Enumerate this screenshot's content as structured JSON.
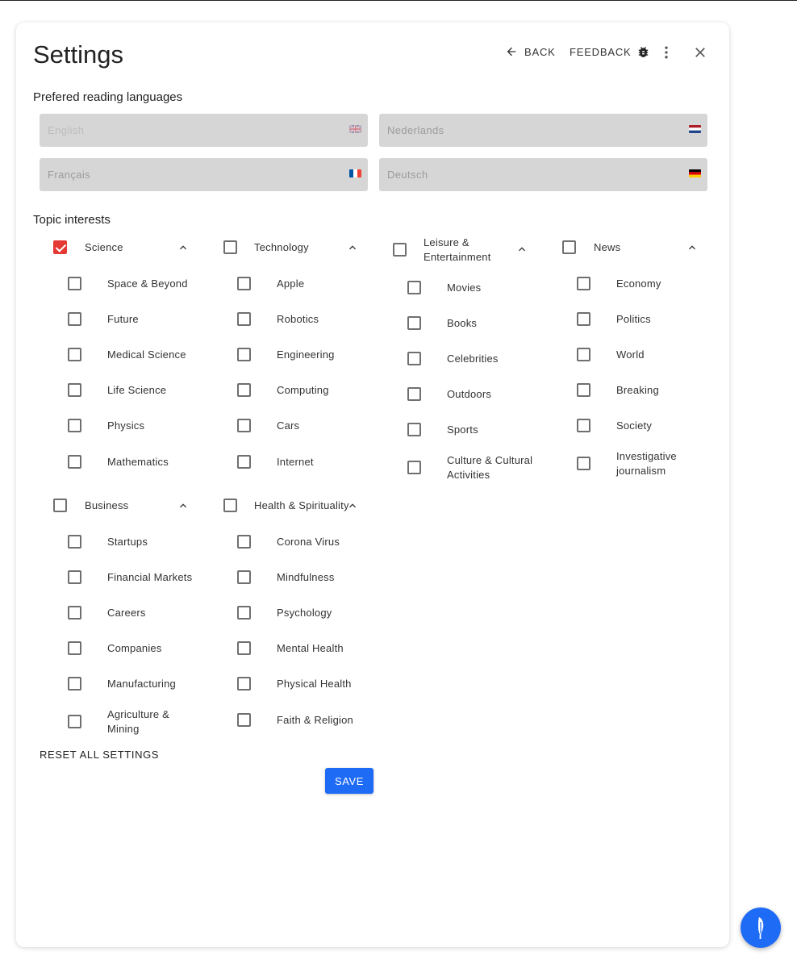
{
  "header": {
    "title": "Settings",
    "back_label": "BACK",
    "feedback_label": "FEEDBACK"
  },
  "languages": {
    "label": "Prefered reading languages",
    "fields": [
      {
        "placeholder": "English",
        "flag": "uk-flag-icon"
      },
      {
        "placeholder": "Nederlands",
        "flag": "netherlands-flag-icon"
      },
      {
        "placeholder": "Français",
        "flag": "france-flag-icon"
      },
      {
        "placeholder": "Deutsch",
        "flag": "germany-flag-icon"
      }
    ]
  },
  "topics": {
    "label": "Topic interests",
    "groups": [
      {
        "label": "Science",
        "checked": true,
        "items": [
          "Space & Beyond",
          "Future",
          "Medical Science",
          "Life Science",
          "Physics",
          "Mathematics"
        ]
      },
      {
        "label": "Technology",
        "checked": false,
        "items": [
          "Apple",
          "Robotics",
          "Engineering",
          "Computing",
          "Cars",
          "Internet"
        ]
      },
      {
        "label": "Leisure & Entertainment",
        "checked": false,
        "items": [
          "Movies",
          "Books",
          "Celebrities",
          "Outdoors",
          "Sports",
          "Culture & Cultural Activities"
        ]
      },
      {
        "label": "News",
        "checked": false,
        "items": [
          "Economy",
          "Politics",
          "World",
          "Breaking",
          "Society",
          "Investigative journalism"
        ]
      },
      {
        "label": "Business",
        "checked": false,
        "items": [
          "Startups",
          "Financial Markets",
          "Careers",
          "Companies",
          "Manufacturing",
          "Agriculture & Mining"
        ]
      },
      {
        "label": "Health & Spirituality",
        "checked": false,
        "items": [
          "Corona Virus",
          "Mindfulness",
          "Psychology",
          "Mental Health",
          "Physical Health",
          "Faith & Religion"
        ]
      }
    ]
  },
  "footer": {
    "reset_label": "RESET ALL SETTINGS",
    "save_label": "SAVE"
  },
  "colors": {
    "accent": "#1e6bf5",
    "checked": "#e53935",
    "field_bg": "#d6d6d6"
  }
}
